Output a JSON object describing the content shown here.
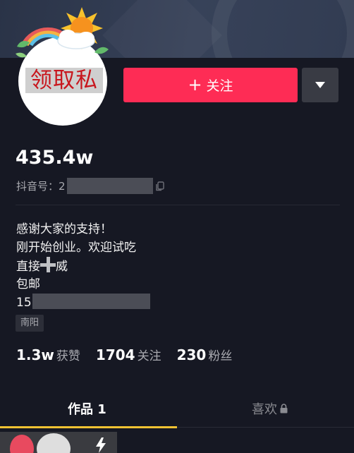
{
  "profile": {
    "avatar_text": "领取私",
    "follow_label": "关注",
    "likes_display": "435.4w",
    "douyin_id_prefix": "抖音号：2"
  },
  "bio": {
    "line1": "感谢大家的支持！",
    "line2": "刚开始创业。欢迎试吃",
    "line3_prefix": "直接",
    "line3_suffix": "威",
    "line4": "包邮",
    "line5_prefix": "15"
  },
  "location": "南阳",
  "stats": {
    "likes_count": "1.3w",
    "likes_label": "获赞",
    "following_count": "1704",
    "following_label": "关注",
    "followers_count": "230",
    "followers_label": "粉丝"
  },
  "tabs": {
    "works": "作品 1",
    "likes": "喜欢"
  },
  "colors": {
    "accent": "#fe2c55",
    "background": "#161823",
    "tab_indicator": "#f0c233"
  },
  "icons": [
    "plus-icon",
    "dropdown-icon",
    "copy-icon",
    "lock-icon",
    "lightning-icon"
  ]
}
